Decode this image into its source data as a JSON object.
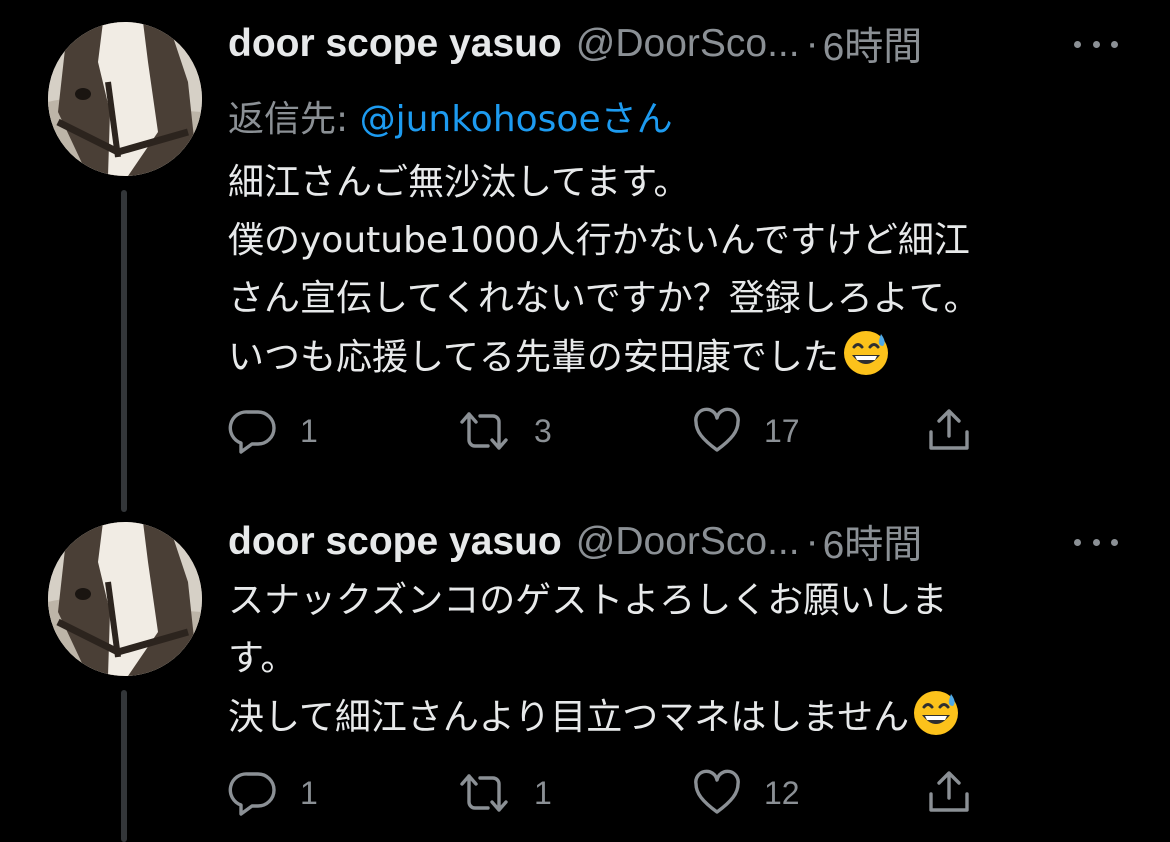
{
  "tweets": [
    {
      "display_name": "door scope yasuo",
      "handle": "@DoorSco...",
      "separator": "·",
      "time": "6時間",
      "reply_label": "返信先:",
      "reply_mention": "@junkohosoeさん",
      "lines": [
        "細江さんご無沙汰してます。",
        "僕のyoutube1000人行かないんですけど細江",
        "さん宣伝してくれないですか？登録しろよて。",
        "いつも応援してる先輩の安田康でした"
      ],
      "emoji": "grinning-sweat-emoji",
      "reply_count": "1",
      "retweet_count": "3",
      "like_count": "17"
    },
    {
      "display_name": "door scope yasuo",
      "handle": "@DoorSco...",
      "separator": "·",
      "time": "6時間",
      "lines": [
        "スナックズンコのゲストよろしくお願いしま",
        "す。",
        "決して細江さんより目立つマネはしません"
      ],
      "emoji": "grinning-sweat-emoji",
      "reply_count": "1",
      "retweet_count": "1",
      "like_count": "12"
    }
  ],
  "colors": {
    "background": "#000000",
    "primary_text": "#e7e9ea",
    "secondary_text": "#8b9095",
    "link": "#1d9bf0",
    "thread_line": "#333639"
  },
  "icons": {
    "reply": "reply-icon",
    "retweet": "retweet-icon",
    "like": "heart-icon",
    "share": "share-icon",
    "more": "more-icon",
    "avatar": "horse-avatar"
  }
}
